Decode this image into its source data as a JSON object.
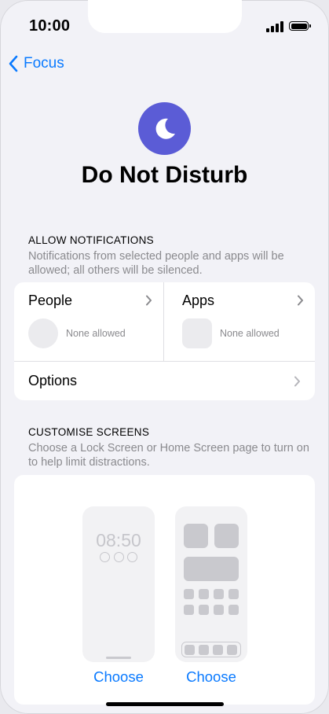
{
  "status_bar": {
    "time": "10:00"
  },
  "nav": {
    "back_label": "Focus"
  },
  "focus": {
    "title": "Do Not Disturb",
    "icon": "moon-icon",
    "accent": "#5b5cd6"
  },
  "allow_notifications": {
    "header": "ALLOW NOTIFICATIONS",
    "description": "Notifications from selected people and apps will be allowed; all others will be silenced.",
    "people": {
      "label": "People",
      "status": "None allowed"
    },
    "apps": {
      "label": "Apps",
      "status": "None allowed"
    },
    "options_label": "Options"
  },
  "customise_screens": {
    "header": "CUSTOMISE SCREENS",
    "description": "Choose a Lock Screen or Home Screen page to turn on to help limit distractions.",
    "lock_preview_time": "08:50",
    "lock_choose_label": "Choose",
    "home_choose_label": "Choose"
  },
  "colors": {
    "link": "#0a7aff",
    "background": "#f2f2f7",
    "secondary_text": "#8a8a8e"
  }
}
